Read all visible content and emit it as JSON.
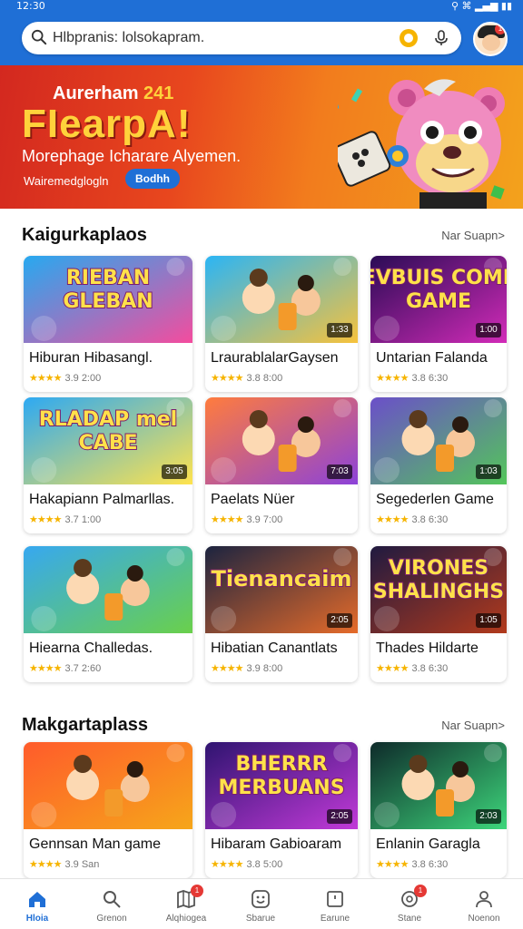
{
  "status": {
    "time": "12:30",
    "icons": "⚲ ⌘ ▂▄▆ ▮▮"
  },
  "search": {
    "placeholder": "Hlbpranis: lolsokapram."
  },
  "banner": {
    "sub_title": "Aurerham",
    "sub_title_num": "241",
    "title": "FIearpA!",
    "description": "Morephage Icharare Alyemen.",
    "small_text": "Wairemedglogln",
    "button_label": "Bodhh"
  },
  "sections": [
    {
      "title": "Kaigurkaplaos",
      "see_all": "Nar Suapn>"
    },
    {
      "title": "Makgartaplass",
      "see_all": "Nar Suapn>"
    }
  ],
  "cards": [
    {
      "name": "Hiburan Hibasangl.",
      "rating": "3.9",
      "plays": "2:00",
      "duration": "",
      "colors": [
        "#27a9f0",
        "#f44c9e"
      ]
    },
    {
      "name": "LraurablalarGaysen",
      "rating": "3.8",
      "plays": "8:00",
      "duration": "1:33",
      "colors": [
        "#2bb5f5",
        "#f7c23c"
      ]
    },
    {
      "name": "Untarian Falanda",
      "rating": "3.8",
      "plays": "6:30",
      "duration": "1:00",
      "colors": [
        "#2a0b55",
        "#d22bb8"
      ]
    },
    {
      "name": "Hakapiann Palmarllas.",
      "rating": "3.7",
      "plays": "1:00",
      "duration": "3:05",
      "colors": [
        "#2da9f3",
        "#ffe34d"
      ]
    },
    {
      "name": "Paelats Nüer",
      "rating": "3.9",
      "plays": "7:00",
      "duration": "7:03",
      "colors": [
        "#ff7c3d",
        "#8c42d9"
      ]
    },
    {
      "name": "Segederlen Game",
      "rating": "3.8",
      "plays": "6:30",
      "duration": "1:03",
      "colors": [
        "#6b4fc9",
        "#53c65a"
      ]
    },
    {
      "name": "Hiearna Challedas.",
      "rating": "3.7",
      "plays": "2:60",
      "duration": "",
      "colors": [
        "#37a8f0",
        "#6ad04b"
      ]
    },
    {
      "name": "Hibatian Canantlats",
      "rating": "3.9",
      "plays": "8:00",
      "duration": "2:05",
      "colors": [
        "#1c2440",
        "#e56b2a"
      ]
    },
    {
      "name": "Thades Hildarte",
      "rating": "3.8",
      "plays": "6:30",
      "duration": "1:05",
      "colors": [
        "#201a40",
        "#b23a1c"
      ]
    },
    {
      "name": "Gennsan Man game",
      "rating": "3.9",
      "plays": "San",
      "duration": "",
      "colors": [
        "#ff5b2b",
        "#f6a61a"
      ]
    },
    {
      "name": "Hibaram Gabioaram",
      "rating": "3.8",
      "plays": "5:00",
      "duration": "2:05",
      "colors": [
        "#2f1470",
        "#c13ad8"
      ]
    },
    {
      "name": "Enlanin Garagla",
      "rating": "3.8",
      "plays": "6:30",
      "duration": "2:03",
      "colors": [
        "#0e2a2a",
        "#3dd67b"
      ]
    }
  ],
  "thumb_texts": [
    "RIEBAN GLEBAN",
    "",
    "NEVBUIS COMER GAME",
    "RLADAP mel CABE",
    "",
    "",
    "",
    "Tienancaim",
    "VIRONES SHALINGHS",
    "",
    "BHERRR MERBUANS",
    ""
  ],
  "bottom_nav": [
    {
      "label": "Hloia",
      "icon": "home-icon",
      "badge": ""
    },
    {
      "label": "Grenon",
      "icon": "search-icon",
      "badge": ""
    },
    {
      "label": "Alqhiogea",
      "icon": "map-icon",
      "badge": "1"
    },
    {
      "label": "Sbarue",
      "icon": "smile-icon",
      "badge": ""
    },
    {
      "label": "Earune",
      "icon": "box-icon",
      "badge": ""
    },
    {
      "label": "Stane",
      "icon": "gamepad-icon",
      "badge": "1"
    },
    {
      "label": "Noenon",
      "icon": "user-icon",
      "badge": ""
    }
  ],
  "theme": {
    "primary": "#1f6fd6",
    "star": "#f6b400",
    "badge": "#e53935"
  }
}
